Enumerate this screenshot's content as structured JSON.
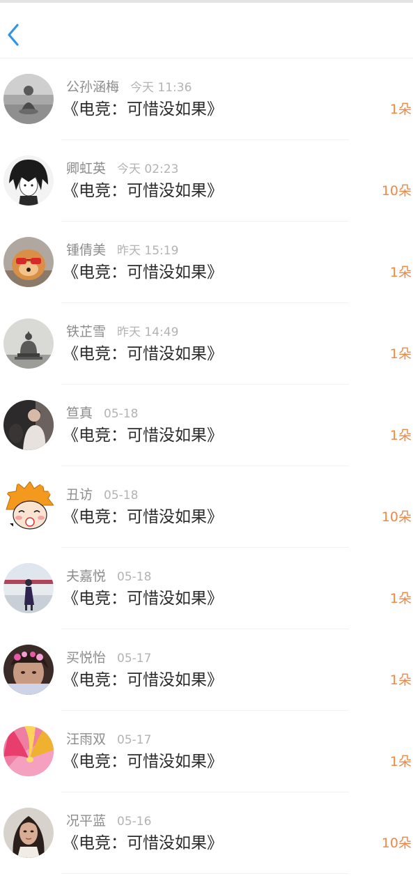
{
  "header": {
    "back_icon": "chevron-left-icon",
    "accent_color": "#2f95ea"
  },
  "colors": {
    "count_color": "#f08843",
    "name_color": "#8c8c8c",
    "time_color": "#b3b3b3"
  },
  "records": [
    {
      "name": "公孙涵梅",
      "time": "今天 11:36",
      "title": "《电竞：可惜没如果》",
      "count": "1朵",
      "avatar": "child-in-grass-photo"
    },
    {
      "name": "卿虹英",
      "time": "今天 02:23",
      "title": "《电竞：可惜没如果》",
      "count": "10朵",
      "avatar": "anime-boy-sketch"
    },
    {
      "name": "锺倩美",
      "time": "昨天 15:19",
      "title": "《电竞：可惜没如果》",
      "count": "1朵",
      "avatar": "puppy-with-sunglasses"
    },
    {
      "name": "铁芷雪",
      "time": "昨天 14:49",
      "title": "《电竞：可惜没如果》",
      "count": "1朵",
      "avatar": "buddha-statue"
    },
    {
      "name": "笪真",
      "time": "05-18",
      "title": "《电竞：可惜没如果》",
      "count": "1朵",
      "avatar": "person-dark-room"
    },
    {
      "name": "丑访",
      "time": "05-18",
      "title": "《电竞：可惜没如果》",
      "count": "10朵",
      "avatar": "cartoon-orange-hair"
    },
    {
      "name": "夫嘉悦",
      "time": "05-18",
      "title": "《电竞：可惜没如果》",
      "count": "1朵",
      "avatar": "girl-on-pier"
    },
    {
      "name": "买悦怡",
      "time": "05-17",
      "title": "《电竞：可惜没如果》",
      "count": "1朵",
      "avatar": "girl-with-flowers"
    },
    {
      "name": "汪雨双",
      "time": "05-17",
      "title": "《电竞：可惜没如果》",
      "count": "1朵",
      "avatar": "pink-flower-closeup"
    },
    {
      "name": "况平蓝",
      "time": "05-16",
      "title": "《电竞：可惜没如果》",
      "count": "10朵",
      "avatar": "woman-portrait"
    }
  ]
}
